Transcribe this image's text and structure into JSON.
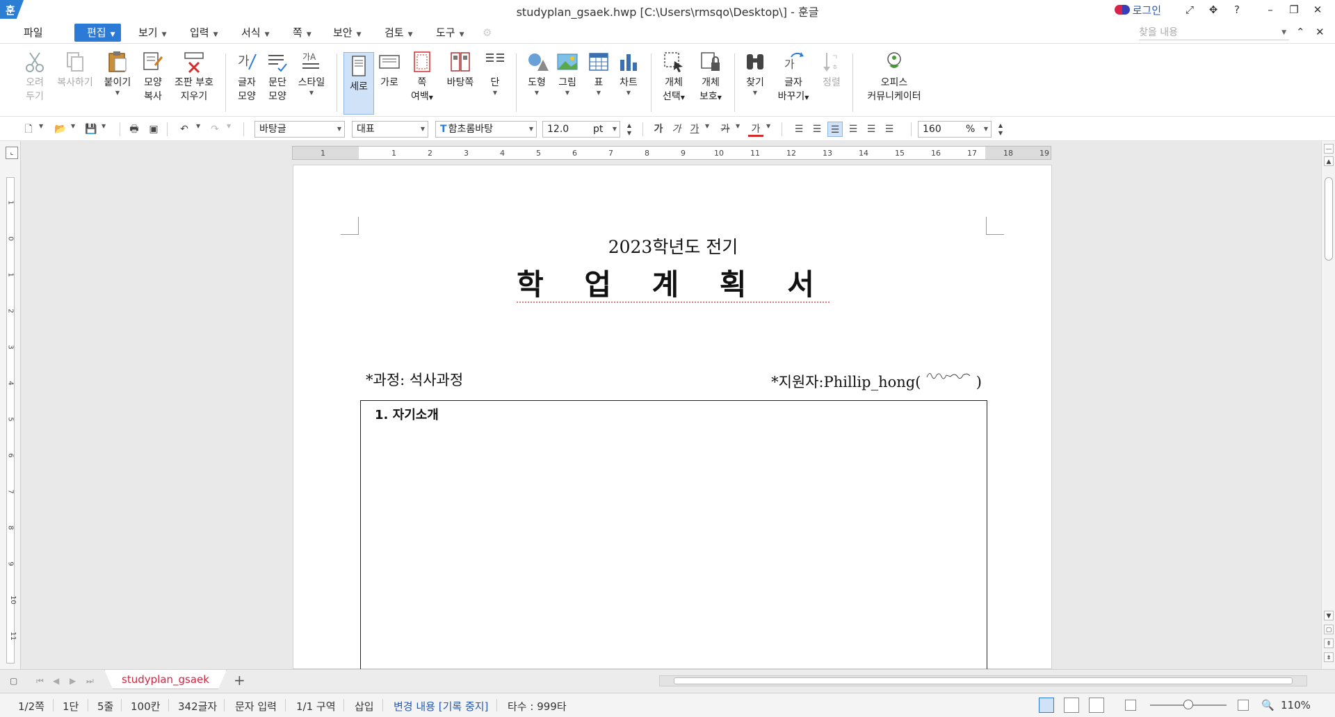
{
  "window": {
    "logo": "훈",
    "title": "studyplan_gsaek.hwp [C:\\Users\\rmsqo\\Desktop\\] - 훈글",
    "login": "로그인"
  },
  "menu": {
    "file": "파일",
    "edit": "편집",
    "view": "보기",
    "input": "입력",
    "format": "서식",
    "page": "쪽",
    "security": "보안",
    "review": "검토",
    "tools": "도구",
    "find_placeholder": "찾을 내용"
  },
  "ribbon": {
    "cut": [
      "오려",
      "두기"
    ],
    "copy": "복사하기",
    "paste": "붙이기",
    "format_copy": [
      "모양",
      "복사"
    ],
    "clear_marks": [
      "조판 부호",
      "지우기"
    ],
    "char_shape": [
      "글자",
      "모양"
    ],
    "para_shape": [
      "문단",
      "모양"
    ],
    "style": "스타일",
    "portrait": "세로",
    "landscape": "가로",
    "page_margin": [
      "쪽",
      "여백"
    ],
    "background": "바탕쪽",
    "columns": "단",
    "shapes": "도형",
    "picture": "그림",
    "table": "표",
    "chart": "차트",
    "select_object": [
      "개체",
      "선택"
    ],
    "protect_object": [
      "개체",
      "보호"
    ],
    "find": "찾기",
    "replace": [
      "글자",
      "바꾸기"
    ],
    "sort": "정렬",
    "office_comm": [
      "오피스",
      "커뮤니케이터"
    ]
  },
  "format_toolbar": {
    "style_name": "바탕글",
    "lang": "대표",
    "font": "함초롬바탕",
    "font_size": "12.0",
    "size_unit": "pt",
    "line_spacing": "160",
    "spacing_unit": "%",
    "bold_glyph": "가",
    "italic_glyph": "가",
    "underline_glyph": "가",
    "strike_glyph": "가",
    "color_glyph": "가"
  },
  "ruler": {
    "h_ticks": [
      "1",
      "1",
      "2",
      "3",
      "4",
      "5",
      "6",
      "7",
      "8",
      "9",
      "10",
      "11",
      "12",
      "13",
      "14",
      "15",
      "16",
      "17",
      "18",
      "19"
    ],
    "v_ticks": [
      "1",
      "0",
      "1",
      "2",
      "3",
      "4",
      "5",
      "6",
      "7",
      "8",
      "9",
      "10",
      "11"
    ]
  },
  "document": {
    "subtitle": "2023학년도 전기",
    "title": "학 업 계 획 서",
    "course_label": "*과정: 석사과정",
    "applicant_label": "*지원자:Phillip_hong(",
    "applicant_close": ")",
    "section1": "1. 자기소개"
  },
  "tabs": {
    "doc_tab": "studyplan_gsaek",
    "add": "+"
  },
  "status": {
    "page": "1/2쪽",
    "column": "1단",
    "line": "5줄",
    "col": "100칸",
    "chars": "342글자",
    "mode": "문자 입력",
    "section": "1/1 구역",
    "insert": "삽입",
    "track": "변경 내용 [기록 중지]",
    "typing": "타수 : 999타",
    "zoom": "110%"
  },
  "colors": {
    "accent": "#2b7ad6",
    "tab_text": "#d2243e",
    "link_blue": "#2457b5"
  }
}
